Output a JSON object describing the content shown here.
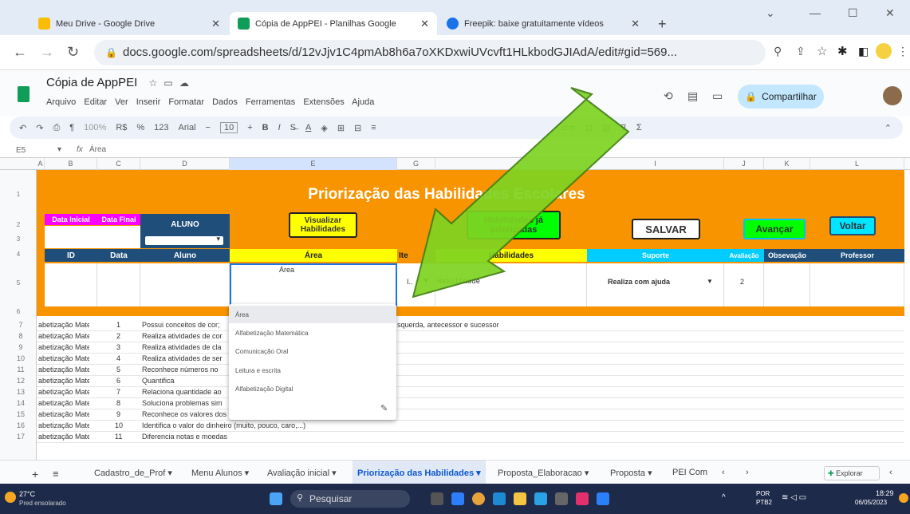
{
  "browser": {
    "tabs": [
      {
        "title": "Meu Drive - Google Drive",
        "color": "#fbbc04"
      },
      {
        "title": "Cópia de AppPEI - Planilhas Google",
        "color": "#0f9d58"
      },
      {
        "title": "Freepik: baixe gratuitamente vídeos",
        "color": "#1a73e8"
      }
    ],
    "url": "docs.google.com/spreadsheets/d/12vJjv1C4pmAb8h6a7oXKDxwiUVcvft1HLkbodGJIAdA/edit#gid=569..."
  },
  "doc": {
    "title": "Cópia de AppPEI",
    "menus": [
      "Arquivo",
      "Editar",
      "Ver",
      "Inserir",
      "Formatar",
      "Dados",
      "Ferramentas",
      "Extensões",
      "Ajuda"
    ],
    "share_label": "Compartilhar"
  },
  "toolbar": {
    "zoom": "100%",
    "currency": "R$",
    "percent": "%",
    "format123": "123",
    "font": "Arial",
    "font_size": "10"
  },
  "formula": {
    "cell_ref": "E5",
    "fx": "fx",
    "value": "Área"
  },
  "columns": [
    "A",
    "B",
    "C",
    "D",
    "E",
    "G",
    "",
    "I",
    "J",
    "K",
    "L"
  ],
  "sheet": {
    "title": "Priorização das Habilidades Escolares",
    "data_inicial": "Data Inicial",
    "data_final": "Data Final",
    "aluno_hdr": "ALUNO",
    "btn_visualizar": "Visualizar Habilidades",
    "btn_habilidades_priorizadas": "Habilidades já priorizadas",
    "btn_salvar": "SALVAR",
    "btn_avancar": "Avançar",
    "btn_voltar": "Voltar",
    "col_id": "ID",
    "col_data": "Data",
    "col_aluno": "Aluno",
    "col_area": "Área",
    "col_item": "Ite",
    "col_habilidades": "Habilidades",
    "col_suporte": "Suporte",
    "col_avaliacao": "Avaliação",
    "col_observacao": "Obsevação",
    "col_professor": "Professor",
    "area_input": "Área",
    "item_value": "I..",
    "habilidade_value": "Habilidade",
    "suporte_value": "Realiza com ajuda",
    "avaliacao_value": "2"
  },
  "rows": [
    {
      "num": "7",
      "area": "abetização Matem",
      "id": "1",
      "desc": "Possui conceitos de cor; ",
      "extra": "squerda, antecessor e sucessor"
    },
    {
      "num": "8",
      "area": "abetização Matem",
      "id": "2",
      "desc": "Realiza atividades de cor",
      "extra": ""
    },
    {
      "num": "9",
      "area": "abetização Matem",
      "id": "3",
      "desc": "Realiza atividades de cla",
      "extra": ""
    },
    {
      "num": "10",
      "area": "abetização Matem",
      "id": "4",
      "desc": "Realiza atividades de ser",
      "extra": ""
    },
    {
      "num": "11",
      "area": "abetização Matem",
      "id": "5",
      "desc": "Reconhece números no ",
      "extra": ""
    },
    {
      "num": "12",
      "area": "abetização Matem",
      "id": "6",
      "desc": "Quantifica",
      "extra": ""
    },
    {
      "num": "13",
      "area": "abetização Matem",
      "id": "7",
      "desc": "Relaciona quantidade ao",
      "extra": ""
    },
    {
      "num": "14",
      "area": "abetização Matem",
      "id": "8",
      "desc": "Soluciona problemas sim",
      "extra": ""
    },
    {
      "num": "15",
      "area": "abetização Matem",
      "id": "9",
      "desc": "Reconhece os valores dos preços dos produtos",
      "extra": ""
    },
    {
      "num": "16",
      "area": "abetização Matem",
      "id": "10",
      "desc": "Identifica o valor do dinheiro (muito, pouco, caro,...)",
      "extra": ""
    },
    {
      "num": "17",
      "area": "abetização Matem",
      "id": "11",
      "desc": "Diferencia notas e moedas",
      "extra": ""
    }
  ],
  "dropdown": {
    "options": [
      "Área",
      "Alfabetização Matemática",
      "Comunicação Oral",
      "Leitura e escrita",
      "Alfabetização Digital"
    ]
  },
  "sheet_tabs": [
    "Cadastro_de_Prof",
    "Menu Alunos",
    "Avaliação inicial",
    "Priorização das Habilidades",
    "Proposta_Elaboracao",
    "Proposta",
    "PEI Com"
  ],
  "explore_label": "Explorar",
  "taskbar": {
    "temp": "27°C",
    "weather": "Pred ensolarado",
    "search": "Pesquisar",
    "lang": "POR",
    "lang2": "PTB2",
    "time": "18:29",
    "date": "06/05/2023"
  }
}
